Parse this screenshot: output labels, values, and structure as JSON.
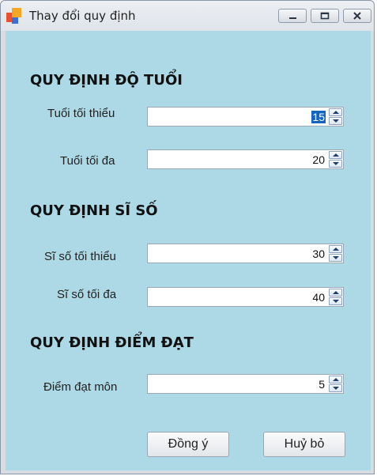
{
  "window": {
    "title": "Thay đổi quy định"
  },
  "sections": {
    "age": "QUY ĐỊNH ĐỘ TUỔI",
    "class_size": "QUY ĐỊNH SĨ SỐ",
    "pass_score": "QUY ĐỊNH ĐIỂM ĐẠT"
  },
  "fields": {
    "min_age": {
      "label": "Tuổi tối thiểu",
      "value": "15"
    },
    "max_age": {
      "label": "Tuổi tối đa",
      "value": "20"
    },
    "min_size": {
      "label": "Sĩ số tối thiểu",
      "value": "30"
    },
    "max_size": {
      "label": "Sĩ số tối đa",
      "value": "40"
    },
    "pass_mark": {
      "label": "Điểm đạt môn",
      "value": "5"
    }
  },
  "buttons": {
    "ok": "Đồng ý",
    "cancel": "Huỷ bỏ"
  },
  "colors": {
    "client_background": "#add8e6",
    "selection": "#1565c0"
  },
  "icons": {
    "app": "app-logo-icon",
    "minimize": "minimize-icon",
    "maximize": "maximize-icon",
    "close": "close-icon",
    "spin_up": "arrow-up-icon",
    "spin_down": "arrow-down-icon"
  }
}
